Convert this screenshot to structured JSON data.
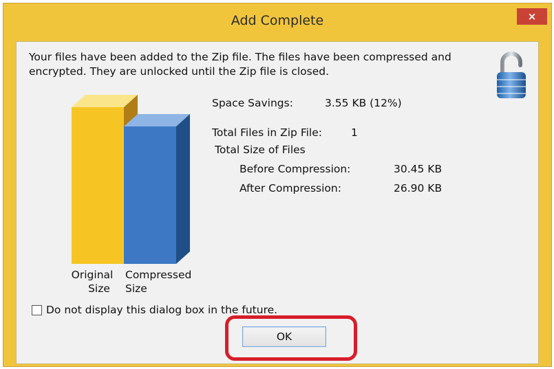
{
  "window": {
    "title": "Add Complete",
    "close_label": "×"
  },
  "message": "Your files have been added to the Zip file. The files have been compressed and encrypted. They are unlocked until the Zip file is closed.",
  "chart": {
    "original_label_line1": "Original",
    "original_label_line2": "Size",
    "compressed_label_line1": "Compressed",
    "compressed_label_line2": "Size",
    "original_color": "#f6c523",
    "compressed_color": "#3c78c4"
  },
  "stats": {
    "space_savings_label": "Space Savings:",
    "space_savings_value": "3.55 KB (12%)",
    "total_files_label": "Total Files in Zip File:",
    "total_files_value": "1",
    "total_size_label": "Total Size of Files",
    "before_label": "Before Compression:",
    "before_value": "30.45 KB",
    "after_label": "After Compression:",
    "after_value": "26.90 KB"
  },
  "checkbox": {
    "label": "Do not display this dialog box in the future.",
    "checked": false
  },
  "buttons": {
    "ok_label": "OK"
  },
  "highlight_color": "#d81d2a"
}
